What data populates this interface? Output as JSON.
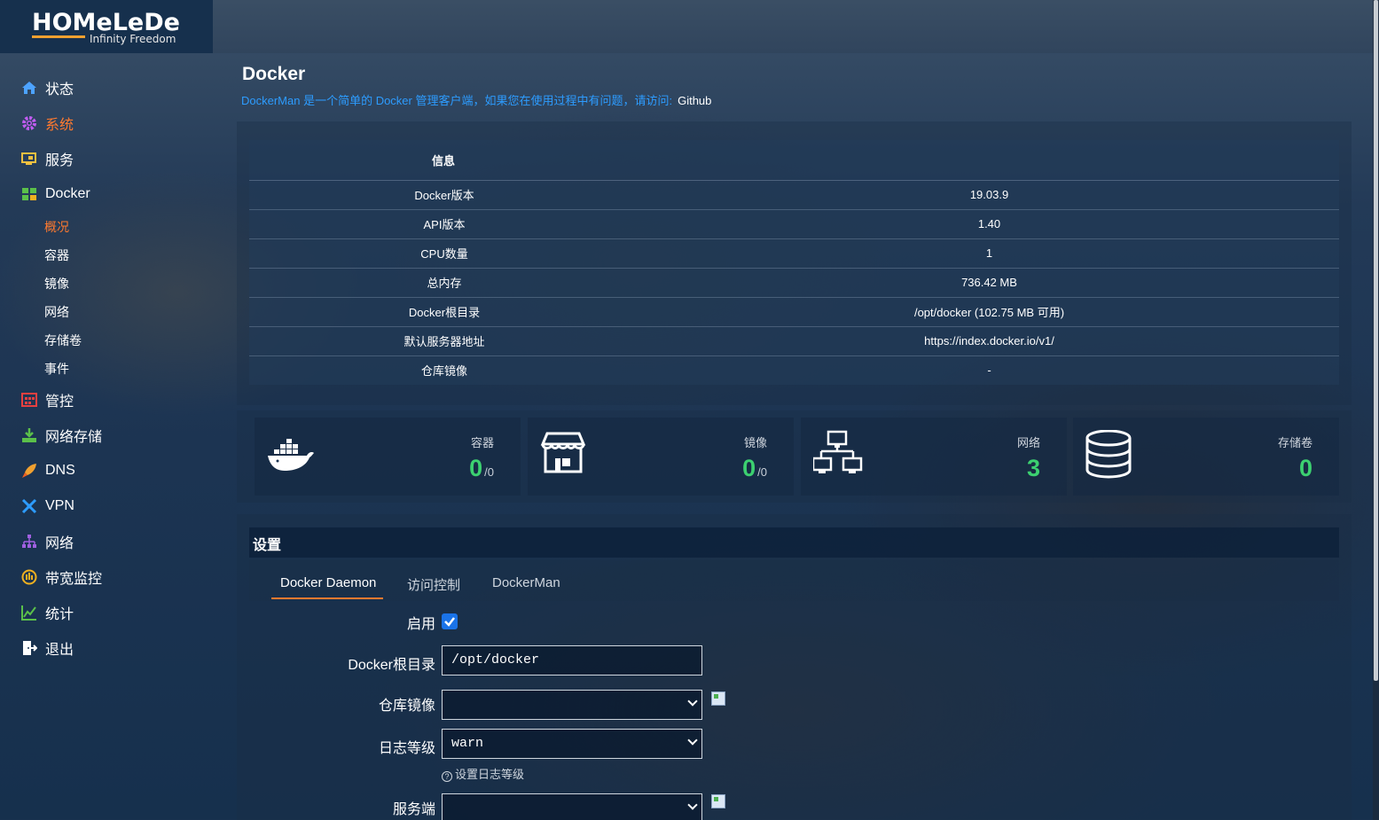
{
  "brand": {
    "name": "HOMeLeDe",
    "tagline": "Infinity Freedom"
  },
  "sidebar": {
    "items": [
      {
        "label": "状态",
        "icon": "home-icon"
      },
      {
        "label": "系统",
        "icon": "gear-icon"
      },
      {
        "label": "服务",
        "icon": "services-icon"
      },
      {
        "label": "Docker",
        "icon": "docker-grid-icon"
      },
      {
        "label": "管控",
        "icon": "control-icon"
      },
      {
        "label": "网络存储",
        "icon": "network-storage-icon"
      },
      {
        "label": "DNS",
        "icon": "rocket-icon"
      },
      {
        "label": "VPN",
        "icon": "vpn-icon"
      },
      {
        "label": "网络",
        "icon": "network-icon"
      },
      {
        "label": "带宽监控",
        "icon": "bandwidth-icon"
      },
      {
        "label": "统计",
        "icon": "chart-icon"
      },
      {
        "label": "退出",
        "icon": "logout-icon"
      }
    ],
    "docker_sub": [
      "概况",
      "容器",
      "镜像",
      "网络",
      "存储卷",
      "事件"
    ]
  },
  "page": {
    "title": "Docker",
    "desc": "DockerMan 是一个简单的 Docker 管理客户端，如果您在使用过程中有问题，请访问:",
    "github": "Github"
  },
  "info": {
    "header": "信息",
    "rows": [
      {
        "k": "Docker版本",
        "v": "19.03.9"
      },
      {
        "k": "API版本",
        "v": "1.40"
      },
      {
        "k": "CPU数量",
        "v": "1"
      },
      {
        "k": "总内存",
        "v": "736.42 MB"
      },
      {
        "k": "Docker根目录",
        "v": "/opt/docker (102.75 MB 可用)"
      },
      {
        "k": "默认服务器地址",
        "v": "https://index.docker.io/v1/"
      },
      {
        "k": "仓库镜像",
        "v": "-"
      }
    ]
  },
  "stats": [
    {
      "title": "容器",
      "value": "0",
      "sub": "/0",
      "icon": "docker-whale-icon"
    },
    {
      "title": "镜像",
      "value": "0",
      "sub": "/0",
      "icon": "store-icon"
    },
    {
      "title": "网络",
      "value": "3",
      "sub": "",
      "icon": "network-topology-icon"
    },
    {
      "title": "存储卷",
      "value": "0",
      "sub": "",
      "icon": "database-icon"
    }
  ],
  "settings": {
    "title": "设置",
    "tabs": [
      "Docker Daemon",
      "访问控制",
      "DockerMan"
    ],
    "enable_label": "启用",
    "enabled": true,
    "root_label": "Docker根目录",
    "root_value": "/opt/docker",
    "mirror_label": "仓库镜像",
    "mirror_value": "",
    "loglevel_label": "日志等级",
    "loglevel_value": "warn",
    "loglevel_hint": "设置日志等级",
    "server_label": "服务端",
    "server_value": ""
  },
  "colors": {
    "accent": "#ff7a2f",
    "link": "#2d9cff",
    "stat_value": "#3cd070",
    "checkbox": "#1a73e8"
  }
}
